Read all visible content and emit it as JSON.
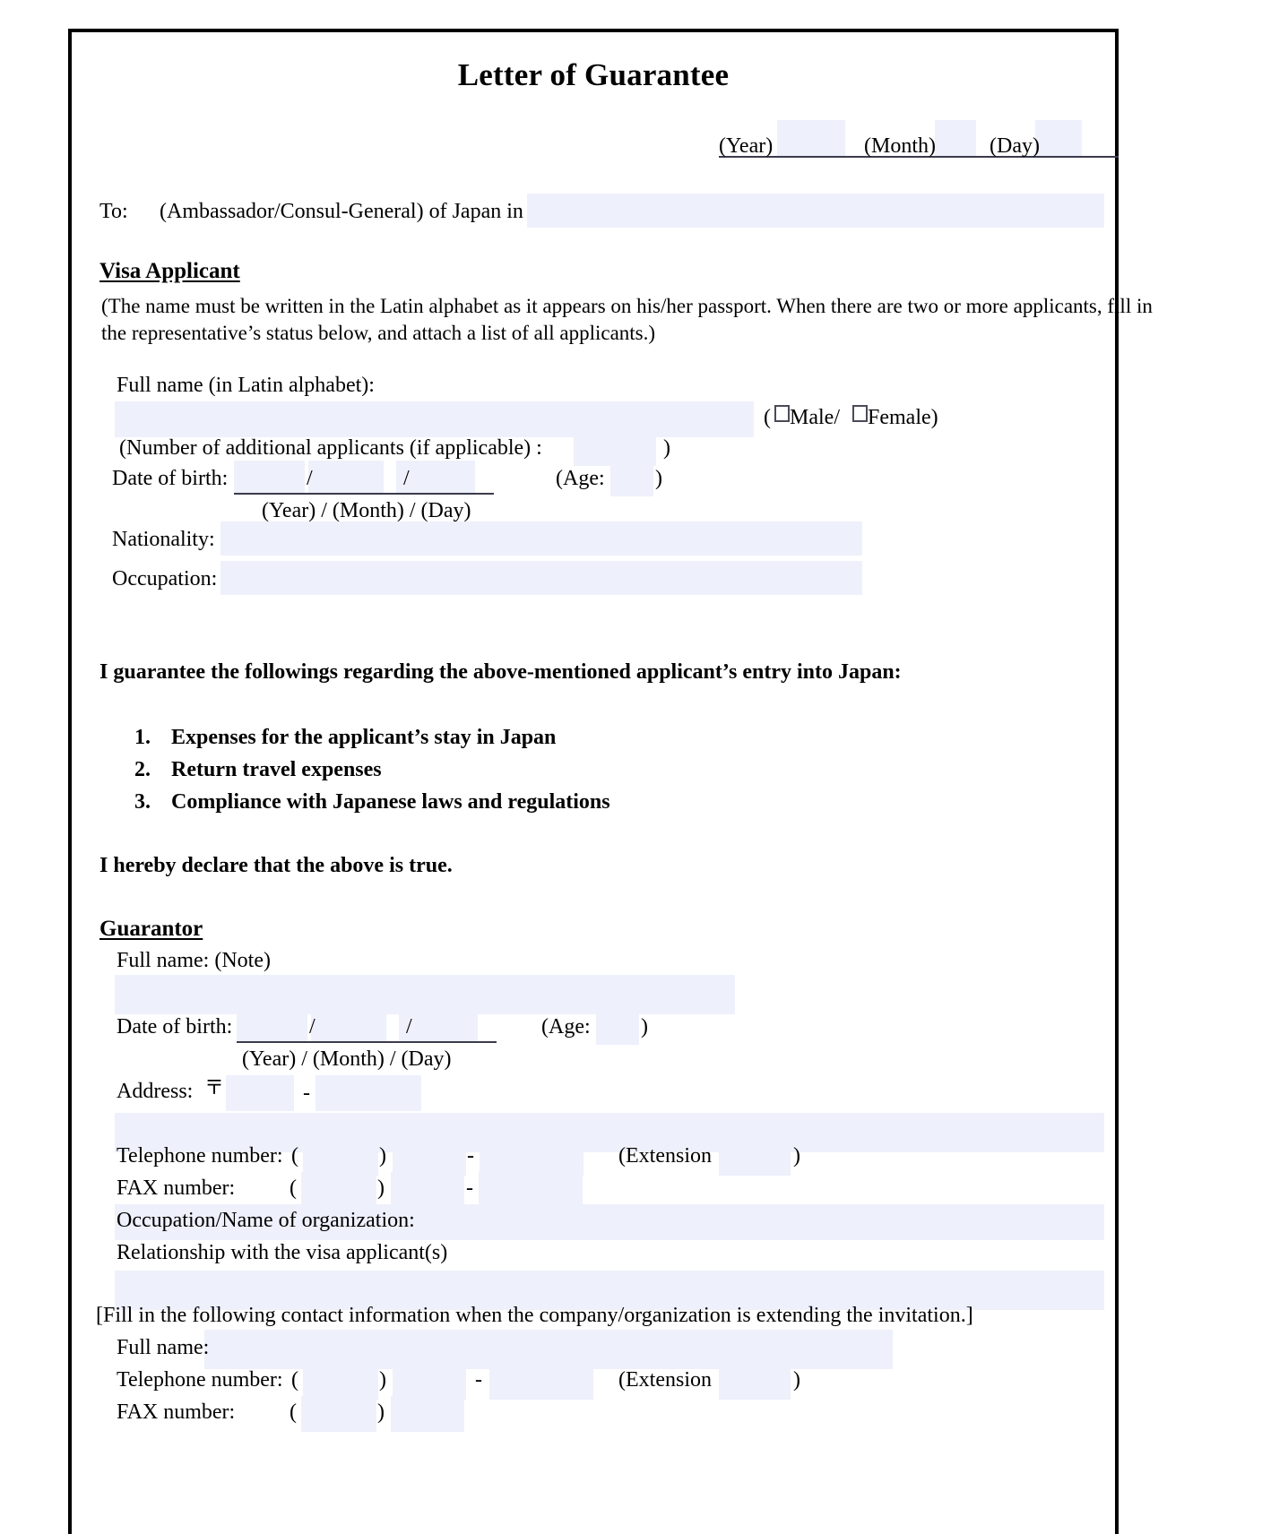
{
  "document": {
    "title": "Letter of Guarantee"
  },
  "date_line": {
    "year_label": "(Year)",
    "month_label": "(Month)",
    "day_label": "(Day)",
    "year_value": "",
    "month_value": "",
    "day_value": ""
  },
  "addressee": {
    "to_label": "To:",
    "text": "(Ambassador/Consul-General) of Japan in",
    "value": ""
  },
  "visa_applicant": {
    "heading": "Visa Applicant",
    "note_line1": "(The name must be written in the Latin alphabet as it appears on his/her passport. When there are two or more applicants, fill in",
    "note_line2": "the representative’s status below, and attach a list of all applicants.)",
    "full_name_label": "Full name (in Latin alphabet):",
    "full_name_value": "",
    "open_paren": "(",
    "male_label": "Male/",
    "female_label": "Female)",
    "additional_applicants_label": "(Number of additional applicants (if applicable) :",
    "additional_applicants_value": "",
    "additional_applicants_close": ")",
    "dob_label": "Date of birth:",
    "dob_year": "",
    "dob_slash1": "/",
    "dob_month": "",
    "dob_slash2": "/",
    "dob_day": "",
    "dob_format": "(Year) / (Month) / (Day)",
    "age_label": "(Age:",
    "age_value": "",
    "age_close": ")",
    "nationality_label": "Nationality:",
    "nationality_value": "",
    "occupation_label": "Occupation:",
    "occupation_value": ""
  },
  "guarantee": {
    "intro": "I guarantee the followings regarding the above-mentioned applicant’s entry into Japan:",
    "items": [
      {
        "num": "1.",
        "text": "Expenses for the applicant’s stay in Japan"
      },
      {
        "num": "2.",
        "text": "Return travel expenses"
      },
      {
        "num": "3.",
        "text": "Compliance with Japanese laws and regulations"
      }
    ],
    "declaration": "I hereby declare that the above is true."
  },
  "guarantor": {
    "heading": "Guarantor",
    "full_name_label": "Full name: (Note)",
    "full_name_value": "",
    "dob_label": "Date of birth:",
    "dob_year": "",
    "dob_slash1": "/",
    "dob_month": "",
    "dob_slash2": "/",
    "dob_day": "",
    "dob_format": "(Year) / (Month) / (Day)",
    "age_label": "(Age:",
    "age_value": "",
    "age_close": ")",
    "address_label": "Address:",
    "postal_mark": "〒",
    "postal_first": "",
    "postal_dash": "-",
    "postal_second": "",
    "address_value": "",
    "tel_label": "Telephone number:",
    "tel_open": "(",
    "tel_area": "",
    "tel_close": ")",
    "tel_prefix": "",
    "tel_dash": "-",
    "tel_number": "",
    "tel_ext_label": "(Extension",
    "tel_ext_value": "",
    "tel_ext_close": ")",
    "fax_label": "FAX number:",
    "fax_open": "(",
    "fax_area": "",
    "fax_close": ")",
    "fax_prefix": "",
    "fax_dash": "-",
    "fax_number": "",
    "occupation_org_label": "Occupation/Name of organization:",
    "occupation_org_value": "",
    "relationship_label": "Relationship with the visa applicant(s)",
    "relationship_value": ""
  },
  "company_contact": {
    "bracket_note": "[Fill in the following contact information when the company/organization is extending the invitation.]",
    "full_name_label": "Full name:",
    "full_name_value": "",
    "tel_label": "Telephone number:",
    "tel_open": "(",
    "tel_area": "",
    "tel_close": ")",
    "tel_prefix": "",
    "tel_dash": "-",
    "tel_number": "",
    "tel_ext_label": "(Extension",
    "tel_ext_value": "",
    "tel_ext_close": ")",
    "fax_label": "FAX number:",
    "fax_open": "(",
    "fax_area": "",
    "fax_close": ")"
  },
  "colors": {
    "field_fill": "#eef0fb",
    "rule": "#3b3b4c",
    "border": "#000000",
    "text": "#000000"
  }
}
